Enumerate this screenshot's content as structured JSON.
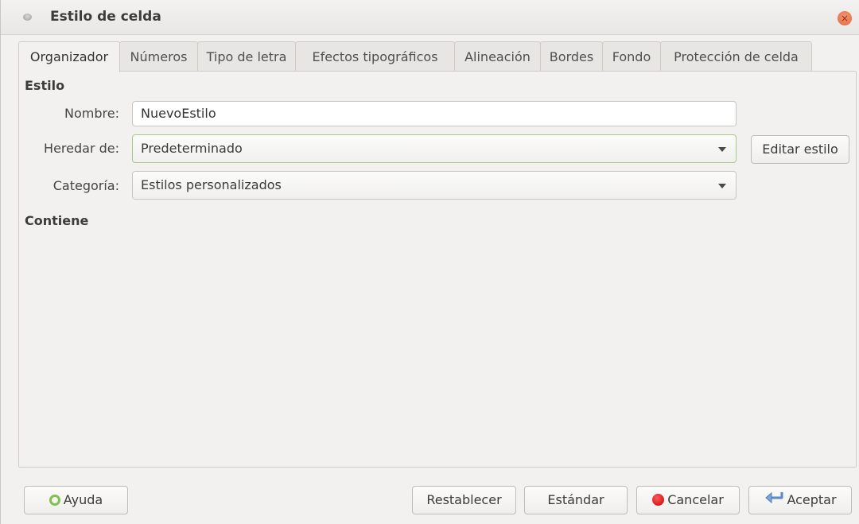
{
  "window": {
    "title": "Estilo de celda",
    "close_glyph": "×"
  },
  "tabs": [
    {
      "label": "Organizador",
      "active": true
    },
    {
      "label": "Números",
      "active": false
    },
    {
      "label": "Tipo de letra",
      "active": false
    },
    {
      "label": "Efectos tipográficos",
      "active": false
    },
    {
      "label": "Alineación",
      "active": false
    },
    {
      "label": "Bordes",
      "active": false
    },
    {
      "label": "Fondo",
      "active": false
    },
    {
      "label": "Protección de celda",
      "active": false
    }
  ],
  "style_section": {
    "title": "Estilo",
    "name_label": "Nombre:",
    "name_value": "NuevoEstilo",
    "inherit_label": "Heredar de:",
    "inherit_value": "Predeterminado",
    "edit_style_button": "Editar estilo",
    "category_label": "Categoría:",
    "category_value": "Estilos personalizados"
  },
  "contains_section": {
    "title": "Contiene"
  },
  "footer": {
    "help_button": "Ayuda",
    "reset_button": "Restablecer",
    "standard_button": "Estándar",
    "cancel_button": "Cancelar",
    "ok_button": "Aceptar"
  },
  "icons": {
    "help": "lifebuoy-icon",
    "cancel": "stop-icon",
    "ok": "return-arrow-icon",
    "dropdown": "chevron-down-icon"
  },
  "colors": {
    "accent_focus": "#a6c986",
    "close_button": "#e2673a",
    "cancel_icon": "#c40000",
    "help_icon": "#7ec24b",
    "ok_icon": "#5b88c9"
  }
}
